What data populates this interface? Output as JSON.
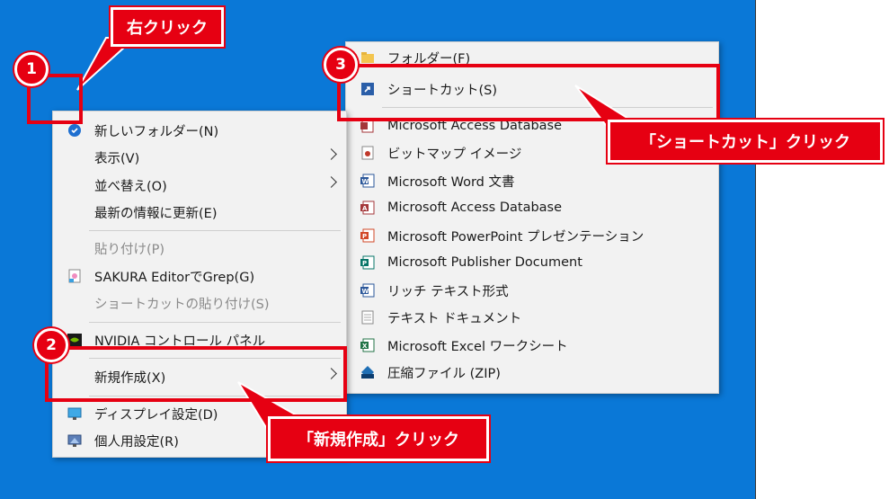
{
  "context_menu": {
    "items": [
      {
        "label": "新しいフォルダー(N)",
        "icon": "folder-new-icon"
      },
      {
        "label": "表示(V)",
        "submenu": true
      },
      {
        "label": "並べ替え(O)",
        "submenu": true
      },
      {
        "label": "最新の情報に更新(E)"
      },
      {
        "label": "貼り付け(P)",
        "disabled": true
      },
      {
        "label": "SAKURA EditorでGrep(G)",
        "icon": "sakura-editor-icon"
      },
      {
        "label": "ショートカットの貼り付け(S)",
        "disabled": true
      },
      {
        "label": "NVIDIA コントロール パネル",
        "icon": "nvidia-icon"
      },
      {
        "label": "新規作成(X)",
        "submenu": true
      },
      {
        "label": "ディスプレイ設定(D)",
        "icon": "display-icon"
      },
      {
        "label": "個人用設定(R)",
        "icon": "personalize-icon"
      }
    ]
  },
  "submenu": {
    "items": [
      {
        "label": "フォルダー(F)",
        "icon": "folder-icon"
      },
      {
        "label": "ショートカット(S)",
        "icon": "shortcut-icon"
      },
      {
        "label": "Microsoft Access Database",
        "icon": "access-icon"
      },
      {
        "label": "ビットマップ イメージ",
        "icon": "bitmap-icon"
      },
      {
        "label": "Microsoft Word 文書",
        "icon": "word-icon"
      },
      {
        "label": "Microsoft Access Database",
        "icon": "access-icon"
      },
      {
        "label": "Microsoft PowerPoint プレゼンテーション",
        "icon": "powerpoint-icon"
      },
      {
        "label": "Microsoft Publisher Document",
        "icon": "publisher-icon"
      },
      {
        "label": "リッチ テキスト形式",
        "icon": "rtf-icon"
      },
      {
        "label": "テキスト ドキュメント",
        "icon": "text-icon"
      },
      {
        "label": "Microsoft Excel ワークシート",
        "icon": "excel-icon"
      },
      {
        "label": "圧縮ファイル (ZIP)",
        "icon": "zip-icon"
      }
    ]
  },
  "annotations": {
    "step1_number": "1",
    "step1_label": "右クリック",
    "step2_number": "2",
    "step2_label": "「新規作成」クリック",
    "step3_number": "3",
    "step3_label": "「ショートカット」クリック"
  },
  "colors": {
    "accent_red": "#e60012",
    "desktop_blue": "#0a78d7"
  }
}
